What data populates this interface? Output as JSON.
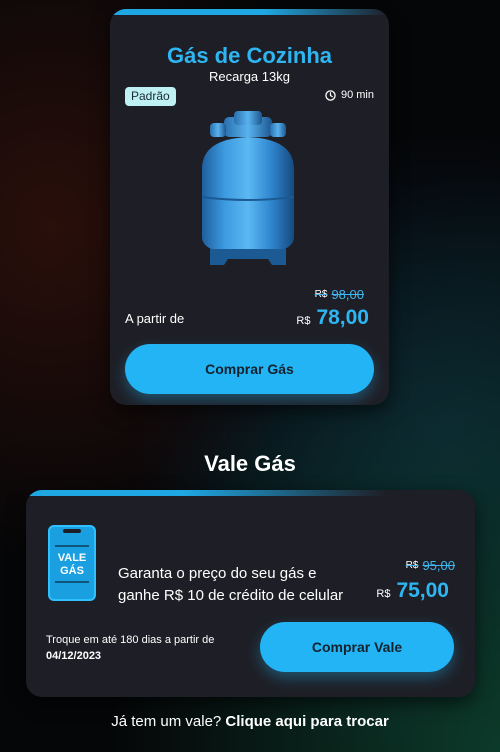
{
  "gas_card": {
    "title": "Gás de Cozinha",
    "subtitle": "Recarga 13kg",
    "badge": "Padrão",
    "delivery_time": "90 min",
    "old_currency": "R$",
    "old_price": "98,00",
    "from_label": "A partir de",
    "currency": "R$",
    "price": "78,00",
    "buy_label": "Comprar Gás"
  },
  "vale_section": {
    "title": "Vale Gás"
  },
  "vale_card": {
    "ticket_line1": "VALE",
    "ticket_line2": "GÁS",
    "description_line1": "Garanta o preço do seu gás e",
    "description_line2": "ganhe R$ 10 de crédito de celular",
    "old_currency": "R$",
    "old_price": "95,00",
    "currency": "R$",
    "price": "75,00",
    "exchange_note": "Troque em até 180 dias a partir de",
    "exchange_date": "04/12/2023",
    "buy_label": "Comprar Vale"
  },
  "footer": {
    "question": "Já tem um vale?",
    "link": "Clique aqui para trocar"
  },
  "colors": {
    "accent": "#22b4f5",
    "card_bg": "#1e1f26",
    "badge_bg": "#bff0f2"
  }
}
